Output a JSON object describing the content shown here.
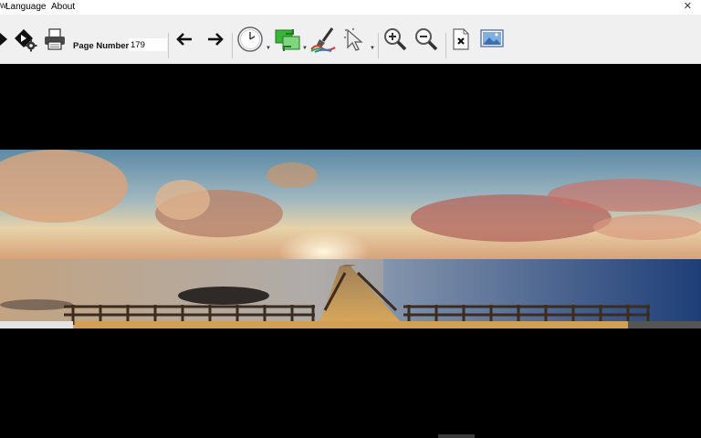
{
  "window": {
    "title_fragment": "w",
    "close_glyph": "✕"
  },
  "menu": {
    "items": [
      "Language",
      "About"
    ]
  },
  "toolbar": {
    "page_label": "Page Number",
    "page_value": "179",
    "buttons": [
      "play-forward-icon",
      "settings-gear-icon",
      "printer-icon",
      "arrow-left-icon",
      "arrow-right-icon",
      "clock-icon",
      "image-swap-icon",
      "color-paint-icon",
      "cursor-select-icon",
      "zoom-in-icon",
      "zoom-out-icon",
      "delete-file-icon",
      "picture-icon"
    ]
  },
  "colors": {
    "toolbar_bg": "#f0f0f0",
    "viewer_bg": "#000000",
    "accent_green": "#2fa82f"
  }
}
